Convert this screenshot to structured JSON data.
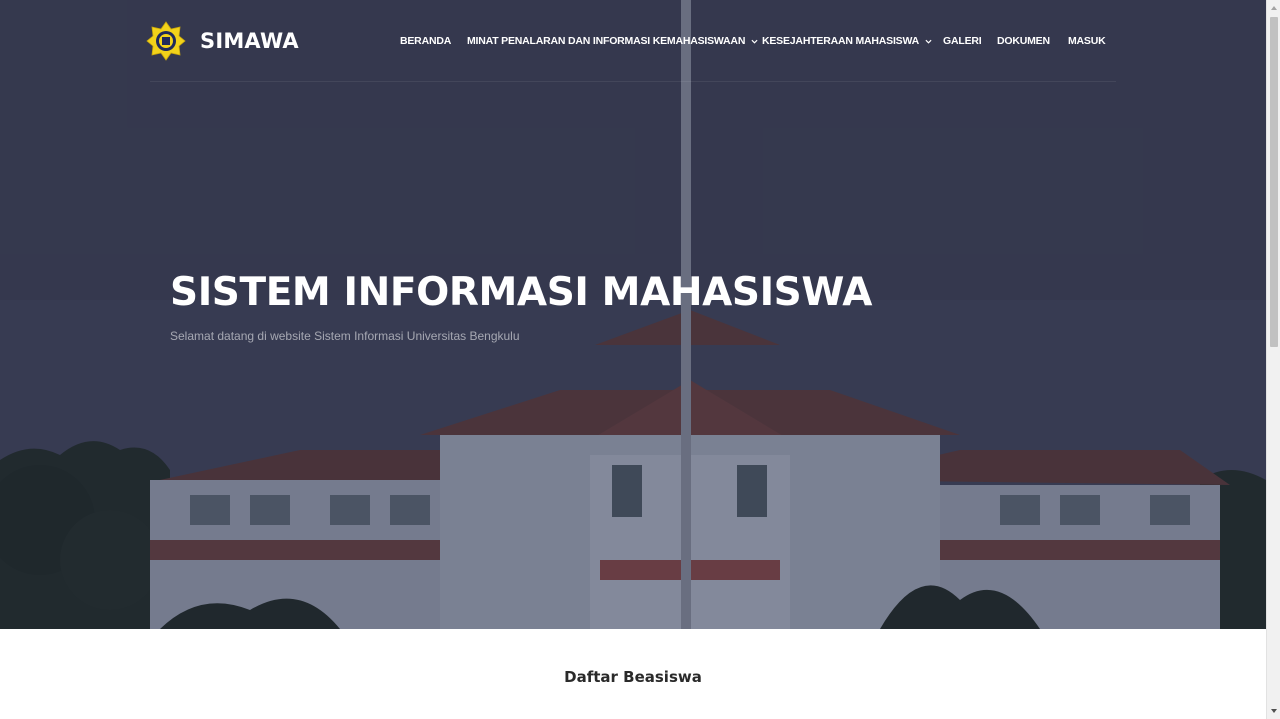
{
  "brand": {
    "name": "SIMAWA",
    "logo_icon": "university-emblem-icon"
  },
  "nav": {
    "items": [
      {
        "label": "BERANDA",
        "has_dropdown": false
      },
      {
        "label": "MINAT PENALARAN DAN INFORMASI KEMAHASISWAAN",
        "has_dropdown": true
      },
      {
        "label": "KESEJAHTERAAN MAHASISWA",
        "has_dropdown": true
      },
      {
        "label": "GALERI",
        "has_dropdown": false
      },
      {
        "label": "DOKUMEN",
        "has_dropdown": false
      },
      {
        "label": "MASUK",
        "has_dropdown": false
      }
    ]
  },
  "hero": {
    "title": "SISTEM INFORMASI MAHASISWA",
    "subtitle": "Selamat datang di website Sistem Informasi Universitas Bengkulu",
    "background_image": "university-building-photo"
  },
  "section": {
    "title": "Daftar Beasiswa"
  },
  "colors": {
    "hero_overlay": "#3a3d52",
    "nav_text": "#ffffff",
    "logo_yellow": "#f2d21a",
    "logo_navy": "#1f2a5c",
    "section_title": "#2a2a2a"
  }
}
